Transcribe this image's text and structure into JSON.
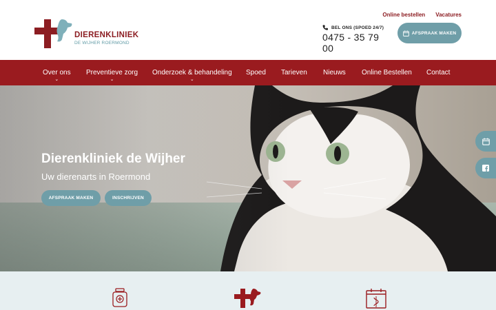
{
  "header": {
    "logo": {
      "title": "DIERENKLINIEK",
      "subtitle": "DE WIJHER ROERMOND"
    },
    "top_links": [
      "Online bestellen",
      "Vacatures"
    ],
    "phone": {
      "label": "BEL ONS (SPOED 24/7)",
      "number": "0475 - 35 79 00",
      "icon": "phone-icon"
    },
    "appointment_button": "AFSPRAAK MAKEN"
  },
  "nav": {
    "items": [
      {
        "label": "Over ons",
        "has_dropdown": true
      },
      {
        "label": "Preventieve zorg",
        "has_dropdown": true
      },
      {
        "label": "Onderzoek & behandeling",
        "has_dropdown": true
      },
      {
        "label": "Spoed",
        "has_dropdown": false
      },
      {
        "label": "Tarieven",
        "has_dropdown": false
      },
      {
        "label": "Nieuws",
        "has_dropdown": false
      },
      {
        "label": "Online Bestellen",
        "has_dropdown": false
      },
      {
        "label": "Contact",
        "has_dropdown": false
      }
    ]
  },
  "hero": {
    "title": "Dierenkliniek de Wijher",
    "subtitle": "Uw dierenarts in Roermond",
    "buttons": [
      "AFSPRAAK MAKEN",
      "INSCHRIJVEN"
    ],
    "side_buttons": [
      "calendar-icon",
      "facebook-icon"
    ]
  },
  "services": {
    "icons": [
      "medicine-bottle-icon",
      "clinic-logo-icon",
      "calendar-appointment-icon"
    ]
  },
  "colors": {
    "brand_red": "#9a1b1f",
    "accent_teal": "#6f9ea8",
    "services_bg": "#e7eff1"
  }
}
